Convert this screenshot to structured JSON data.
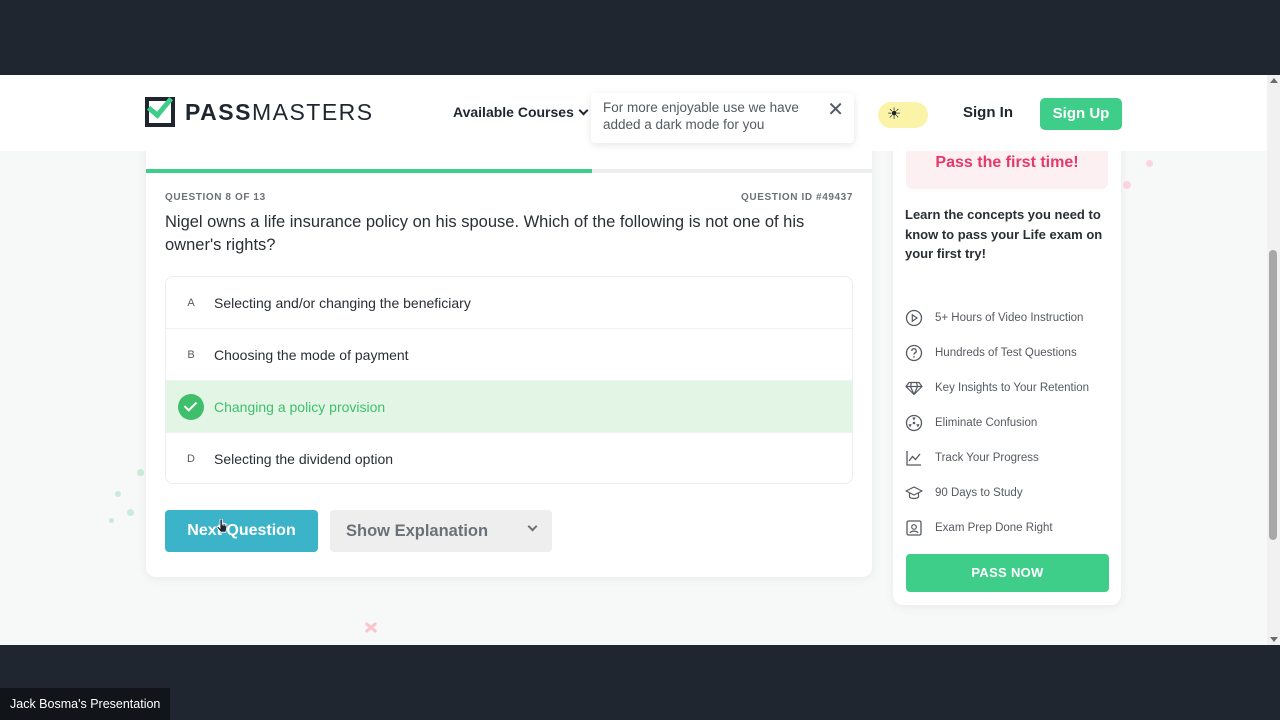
{
  "brand": {
    "name_bold": "PASS",
    "name_rest": "MASTERS",
    "accent": "#3fce8a"
  },
  "nav": {
    "courses_label": "Available Courses",
    "toast_text": "For more enjoyable use we have added a dark mode for you",
    "toast_close": "✕",
    "signin_label": "Sign In",
    "signup_label": "Sign Up"
  },
  "quiz": {
    "progress_percent": 61.5,
    "counter": "QUESTION 8 OF 13",
    "question_id": "QUESTION ID #49437",
    "question": "Nigel owns a life insurance policy on his spouse. Which of the following is not one of his owner's rights?",
    "options": [
      {
        "letter": "A",
        "text": "Selecting and/or changing the beneficiary",
        "state": "default"
      },
      {
        "letter": "B",
        "text": "Choosing the mode of payment",
        "state": "default"
      },
      {
        "letter": "C",
        "text": "Changing a policy provision",
        "state": "correct"
      },
      {
        "letter": "D",
        "text": "Selecting the dividend option",
        "state": "default"
      }
    ],
    "next_label": "Next Question",
    "explain_label": "Show Explanation",
    "correct_color": "#3fbf6c",
    "next_color": "#3bb3c8"
  },
  "sidebar": {
    "banner": "Pass the first time!",
    "lead": "Learn the concepts you need to know to pass your Life exam on your first try!",
    "features": [
      {
        "icon": "play-circle-icon",
        "label": "5+ Hours of Video Instruction"
      },
      {
        "icon": "question-circle-icon",
        "label": "Hundreds of Test Questions"
      },
      {
        "icon": "diamond-icon",
        "label": "Key Insights to Your Retention"
      },
      {
        "icon": "hazard-icon",
        "label": "Eliminate Confusion"
      },
      {
        "icon": "chart-line-icon",
        "label": "Track Your Progress"
      },
      {
        "icon": "graduation-cap-icon",
        "label": "90 Days to Study"
      },
      {
        "icon": "image-frame-icon",
        "label": "Exam Prep Done Right"
      }
    ],
    "cta": "PASS NOW"
  },
  "presenter_label": "Jack Bosma's Presentation"
}
